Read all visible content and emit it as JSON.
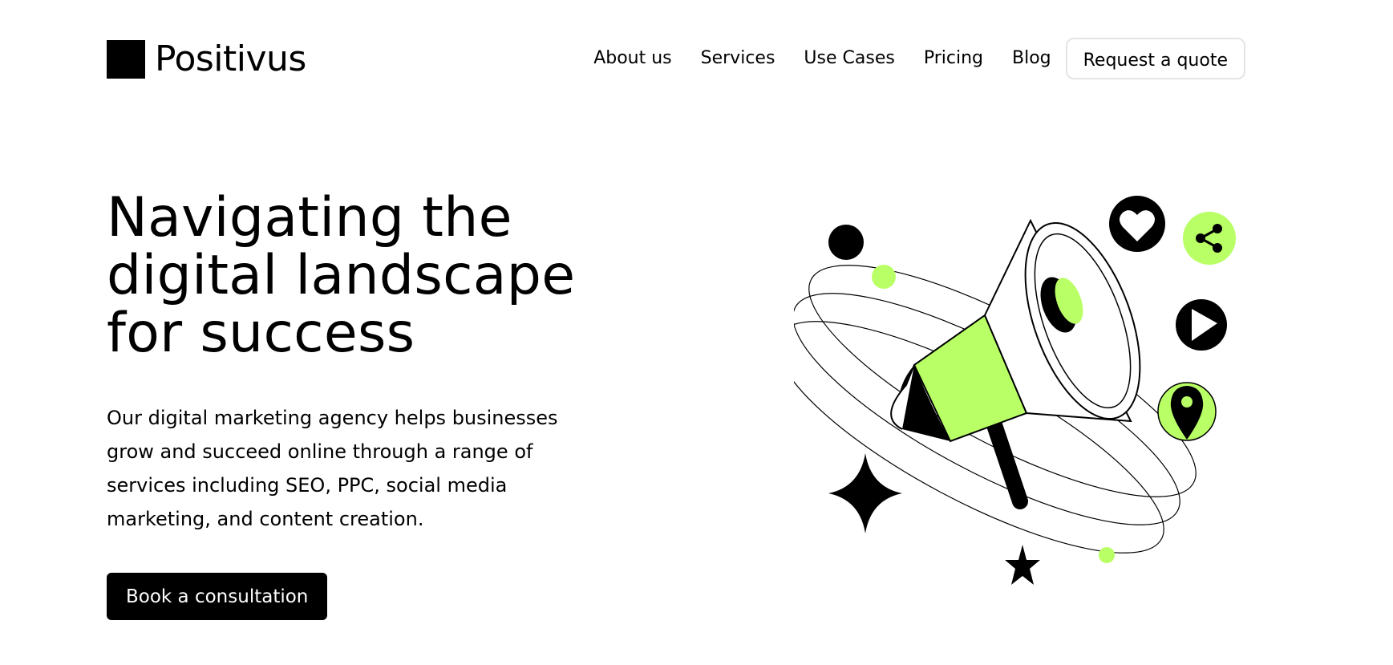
{
  "brand": {
    "name": "Positivus",
    "accent_color": "#B9FF66",
    "dark_color": "#191A23"
  },
  "nav": {
    "items": [
      {
        "label": "About us"
      },
      {
        "label": "Services"
      },
      {
        "label": "Use Cases"
      },
      {
        "label": "Pricing"
      },
      {
        "label": "Blog"
      }
    ],
    "quote_button": "Request a quote"
  },
  "hero": {
    "title_lines": [
      "Navigating the",
      "digital landscape",
      "for success"
    ],
    "description_lines": [
      "Our digital marketing agency helps businesses",
      "grow and succeed online through a range of",
      "services including SEO, PPC, social media",
      "marketing, and content creation."
    ],
    "cta_label": "Book a consultation"
  },
  "illustration": {
    "icons": [
      "megaphone-icon",
      "heart-icon",
      "share-icon",
      "play-icon",
      "location-pin-icon",
      "sparkle-star-icon"
    ]
  }
}
